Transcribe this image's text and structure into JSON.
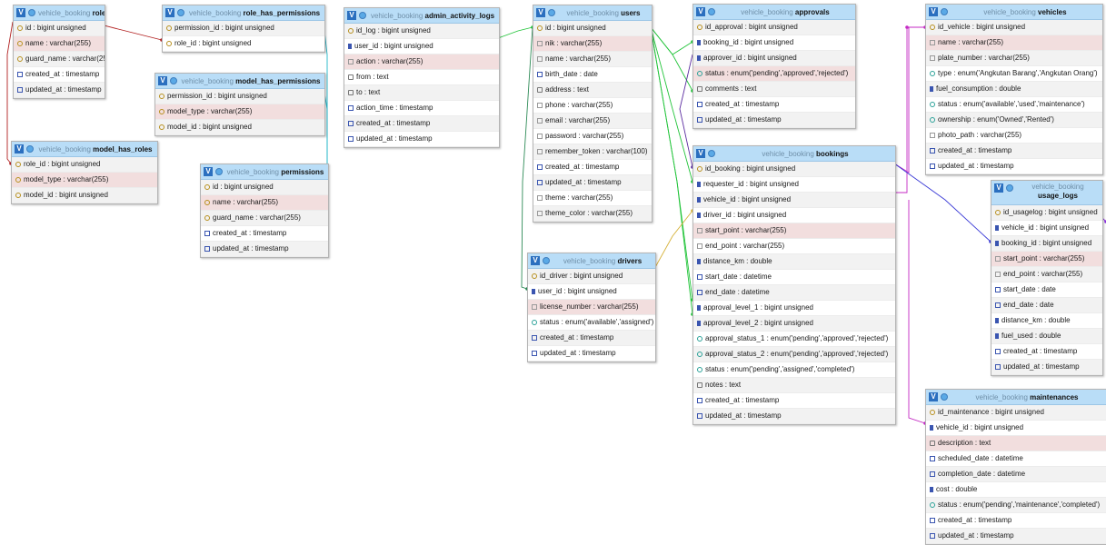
{
  "db_name": "vehicle_booking",
  "link_colors": [
    "#b22222",
    "#1fb6c9",
    "#22c43a",
    "#2e8b57",
    "#d6b23a",
    "#5b2ca0",
    "#c42ac4",
    "#3b3bd6",
    "#8a2be2"
  ],
  "tables": [
    {
      "name": "roles",
      "fields": [
        {
          "t": "id : bigint unsigned",
          "i": "key"
        },
        {
          "t": "name : varchar(255)",
          "i": "key",
          "h": true
        },
        {
          "t": "guard_name : varchar(255)",
          "i": "key"
        },
        {
          "t": "created_at : timestamp",
          "i": "dt"
        },
        {
          "t": "updated_at : timestamp",
          "i": "dt"
        }
      ]
    },
    {
      "name": "role_has_permissions",
      "fields": [
        {
          "t": "permission_id : bigint unsigned",
          "i": "key"
        },
        {
          "t": "role_id : bigint unsigned",
          "i": "key"
        }
      ]
    },
    {
      "name": "model_has_permissions",
      "fields": [
        {
          "t": "permission_id : bigint unsigned",
          "i": "key"
        },
        {
          "t": "model_type : varchar(255)",
          "i": "key",
          "h": true
        },
        {
          "t": "model_id : bigint unsigned",
          "i": "key"
        }
      ]
    },
    {
      "name": "model_has_roles",
      "fields": [
        {
          "t": "role_id : bigint unsigned",
          "i": "key"
        },
        {
          "t": "model_type : varchar(255)",
          "i": "key",
          "h": true
        },
        {
          "t": "model_id : bigint unsigned",
          "i": "key"
        }
      ]
    },
    {
      "name": "permissions",
      "fields": [
        {
          "t": "id : bigint unsigned",
          "i": "key"
        },
        {
          "t": "name : varchar(255)",
          "i": "key",
          "h": true
        },
        {
          "t": "guard_name : varchar(255)",
          "i": "key"
        },
        {
          "t": "created_at : timestamp",
          "i": "dt"
        },
        {
          "t": "updated_at : timestamp",
          "i": "dt"
        }
      ]
    },
    {
      "name": "admin_activity_logs",
      "fields": [
        {
          "t": "id_log : bigint unsigned",
          "i": "key"
        },
        {
          "t": "user_id : bigint unsigned",
          "i": "num"
        },
        {
          "t": "action : varchar(255)",
          "i": "str",
          "h": true
        },
        {
          "t": "from : text",
          "i": "txt"
        },
        {
          "t": "to : text",
          "i": "txt"
        },
        {
          "t": "action_time : timestamp",
          "i": "dt"
        },
        {
          "t": "created_at : timestamp",
          "i": "dt"
        },
        {
          "t": "updated_at : timestamp",
          "i": "dt"
        }
      ]
    },
    {
      "name": "users",
      "fields": [
        {
          "t": "id : bigint unsigned",
          "i": "key"
        },
        {
          "t": "nik : varchar(255)",
          "i": "str",
          "h": true
        },
        {
          "t": "name : varchar(255)",
          "i": "str"
        },
        {
          "t": "birth_date : date",
          "i": "dt"
        },
        {
          "t": "address : text",
          "i": "txt"
        },
        {
          "t": "phone : varchar(255)",
          "i": "str"
        },
        {
          "t": "email : varchar(255)",
          "i": "str"
        },
        {
          "t": "password : varchar(255)",
          "i": "str"
        },
        {
          "t": "remember_token : varchar(100)",
          "i": "str"
        },
        {
          "t": "created_at : timestamp",
          "i": "dt"
        },
        {
          "t": "updated_at : timestamp",
          "i": "dt"
        },
        {
          "t": "theme : varchar(255)",
          "i": "str"
        },
        {
          "t": "theme_color : varchar(255)",
          "i": "str"
        }
      ]
    },
    {
      "name": "drivers",
      "fields": [
        {
          "t": "id_driver : bigint unsigned",
          "i": "key"
        },
        {
          "t": "user_id : bigint unsigned",
          "i": "num"
        },
        {
          "t": "license_number : varchar(255)",
          "i": "str",
          "h": true
        },
        {
          "t": "status : enum('available','assigned')",
          "i": "en"
        },
        {
          "t": "created_at : timestamp",
          "i": "dt"
        },
        {
          "t": "updated_at : timestamp",
          "i": "dt"
        }
      ]
    },
    {
      "name": "approvals",
      "fields": [
        {
          "t": "id_approval : bigint unsigned",
          "i": "key"
        },
        {
          "t": "booking_id : bigint unsigned",
          "i": "num"
        },
        {
          "t": "approver_id : bigint unsigned",
          "i": "num"
        },
        {
          "t": "status : enum('pending','approved','rejected')",
          "i": "en",
          "h": true
        },
        {
          "t": "comments : text",
          "i": "txt"
        },
        {
          "t": "created_at : timestamp",
          "i": "dt"
        },
        {
          "t": "updated_at : timestamp",
          "i": "dt"
        }
      ]
    },
    {
      "name": "bookings",
      "fields": [
        {
          "t": "id_booking : bigint unsigned",
          "i": "key"
        },
        {
          "t": "requester_id : bigint unsigned",
          "i": "num"
        },
        {
          "t": "vehicle_id : bigint unsigned",
          "i": "num"
        },
        {
          "t": "driver_id : bigint unsigned",
          "i": "num"
        },
        {
          "t": "start_point : varchar(255)",
          "i": "str",
          "h": true
        },
        {
          "t": "end_point : varchar(255)",
          "i": "str"
        },
        {
          "t": "distance_km : double",
          "i": "num"
        },
        {
          "t": "start_date : datetime",
          "i": "dt"
        },
        {
          "t": "end_date : datetime",
          "i": "dt"
        },
        {
          "t": "approval_level_1 : bigint unsigned",
          "i": "num"
        },
        {
          "t": "approval_level_2 : bigint unsigned",
          "i": "num"
        },
        {
          "t": "approval_status_1 : enum('pending','approved','rejected')",
          "i": "en"
        },
        {
          "t": "approval_status_2 : enum('pending','approved','rejected')",
          "i": "en"
        },
        {
          "t": "status : enum('pending','assigned','completed')",
          "i": "en"
        },
        {
          "t": "notes : text",
          "i": "txt"
        },
        {
          "t": "created_at : timestamp",
          "i": "dt"
        },
        {
          "t": "updated_at : timestamp",
          "i": "dt"
        }
      ]
    },
    {
      "name": "vehicles",
      "fields": [
        {
          "t": "id_vehicle : bigint unsigned",
          "i": "key"
        },
        {
          "t": "name : varchar(255)",
          "i": "str",
          "h": true
        },
        {
          "t": "plate_number : varchar(255)",
          "i": "str"
        },
        {
          "t": "type : enum('Angkutan Barang','Angkutan Orang')",
          "i": "en"
        },
        {
          "t": "fuel_consumption : double",
          "i": "num"
        },
        {
          "t": "status : enum('available','used','maintenance')",
          "i": "en"
        },
        {
          "t": "ownership : enum('Owned','Rented')",
          "i": "en"
        },
        {
          "t": "photo_path : varchar(255)",
          "i": "str"
        },
        {
          "t": "created_at : timestamp",
          "i": "dt"
        },
        {
          "t": "updated_at : timestamp",
          "i": "dt"
        }
      ]
    },
    {
      "name": "usage_logs",
      "fields": [
        {
          "t": "id_usagelog : bigint unsigned",
          "i": "key"
        },
        {
          "t": "vehicle_id : bigint unsigned",
          "i": "num"
        },
        {
          "t": "booking_id : bigint unsigned",
          "i": "num"
        },
        {
          "t": "start_point : varchar(255)",
          "i": "str",
          "h": true
        },
        {
          "t": "end_point : varchar(255)",
          "i": "str"
        },
        {
          "t": "start_date : date",
          "i": "dt"
        },
        {
          "t": "end_date : date",
          "i": "dt"
        },
        {
          "t": "distance_km : double",
          "i": "num"
        },
        {
          "t": "fuel_used : double",
          "i": "num"
        },
        {
          "t": "created_at : timestamp",
          "i": "dt"
        },
        {
          "t": "updated_at : timestamp",
          "i": "dt"
        }
      ]
    },
    {
      "name": "maintenances",
      "fields": [
        {
          "t": "id_maintenance : bigint unsigned",
          "i": "key"
        },
        {
          "t": "vehicle_id : bigint unsigned",
          "i": "num"
        },
        {
          "t": "description : text",
          "i": "txt",
          "h": true
        },
        {
          "t": "scheduled_date : datetime",
          "i": "dt"
        },
        {
          "t": "completion_date : datetime",
          "i": "dt"
        },
        {
          "t": "cost : double",
          "i": "num"
        },
        {
          "t": "status : enum('pending','maintenance','completed')",
          "i": "en"
        },
        {
          "t": "created_at : timestamp",
          "i": "dt"
        },
        {
          "t": "updated_at : timestamp",
          "i": "dt"
        }
      ]
    }
  ]
}
